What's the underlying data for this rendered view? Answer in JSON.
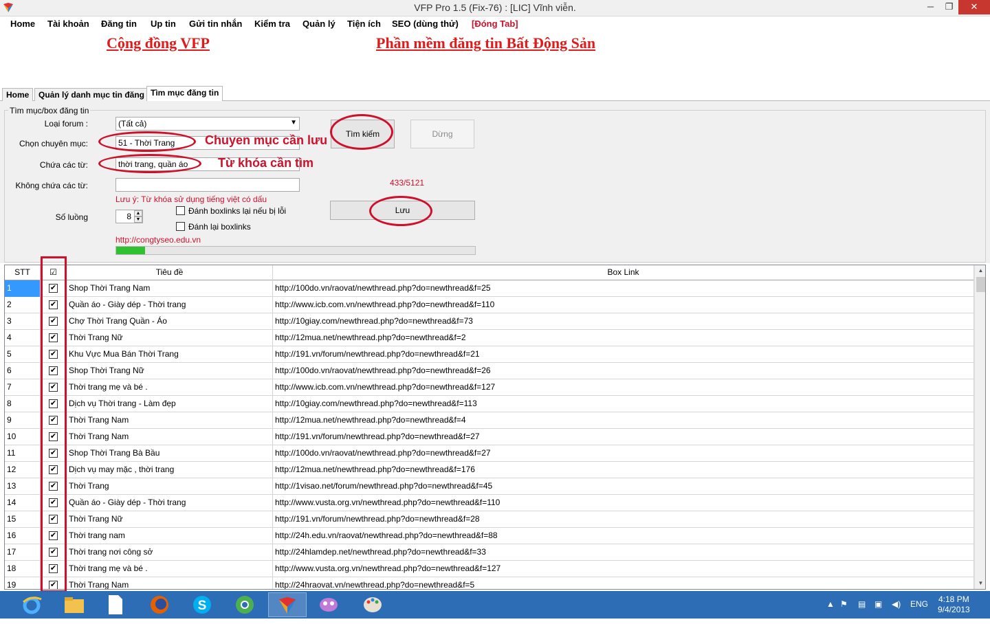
{
  "window": {
    "title": "VFP Pro 1.5 (Fix-76) : [LIC] Vĩnh viễn.",
    "min": "─",
    "max": "❐",
    "close": "✕"
  },
  "menu": [
    "Home",
    "Tài khoản",
    "Đăng tin",
    "Up tin",
    "Gửi tin nhắn",
    "Kiểm tra",
    "Quản lý",
    "Tiện ích",
    "SEO (dùng thử)",
    "[Đóng Tab]"
  ],
  "banner": {
    "left": "Cộng đồng VFP",
    "right": "Phần mềm đăng tin Bất Động Sản"
  },
  "tabs": [
    "Home",
    "Quản lý danh mục tin đăng",
    "Tìm mục đăng tin"
  ],
  "form": {
    "group_title": "Tìm mục/box đăng tin",
    "forum_type_label": "Loại forum :",
    "forum_type_value": "(Tất cả)",
    "category_label": "Chọn chuyên mục:",
    "category_value": "51 - Thời Trang",
    "contains_label": "Chứa các từ:",
    "contains_value": "thời trang, quần áo",
    "not_contains_label": "Không chứa các từ:",
    "not_contains_value": "",
    "note": "Lưu ý:  Từ khóa sử dụng tiếng việt có dấu",
    "quantity_label": "Số luồng",
    "quantity_value": "8",
    "check_repost_label": "Đánh boxlinks lại nếu bị lỗi",
    "check_relink_label": "Đánh lại boxlinks",
    "search_button": "Tìm kiếm",
    "stop_button": "Dừng",
    "save_button": "Lưu",
    "counter": "433/5121",
    "url": "http://congtyseo.edu.vn",
    "progress": 0.08
  },
  "annotations": {
    "category": "Chuyen mục cần lưu",
    "keywords": "Từ khóa cần tìm"
  },
  "grid": {
    "headers": {
      "stt": "STT",
      "check": "☑",
      "title": "Tiêu đề",
      "link": "Box Link"
    },
    "rows": [
      {
        "stt": "1",
        "title": "Shop Thời Trang Nam",
        "link": "http://100do.vn/raovat/newthread.php?do=newthread&f=25"
      },
      {
        "stt": "2",
        "title": "Quần áo - Giày dép - Thời trang",
        "link": "http://www.icb.com.vn/newthread.php?do=newthread&f=110"
      },
      {
        "stt": "3",
        "title": "Chợ Thời Trang Quần - Áo",
        "link": "http://10giay.com/newthread.php?do=newthread&f=73"
      },
      {
        "stt": "4",
        "title": "Thời Trang Nữ",
        "link": "http://12mua.net/newthread.php?do=newthread&f=2"
      },
      {
        "stt": "5",
        "title": "Khu Vực Mua Bán Thời Trang",
        "link": "http://191.vn/forum/newthread.php?do=newthread&f=21"
      },
      {
        "stt": "6",
        "title": "Shop Thời Trang Nữ",
        "link": "http://100do.vn/raovat/newthread.php?do=newthread&f=26"
      },
      {
        "stt": "7",
        "title": "Thời trang mẹ và bé .",
        "link": "http://www.icb.com.vn/newthread.php?do=newthread&f=127"
      },
      {
        "stt": "8",
        "title": "Dịch vụ Thời trang - Làm đẹp",
        "link": "http://10giay.com/newthread.php?do=newthread&f=113"
      },
      {
        "stt": "9",
        "title": "Thời Trang Nam",
        "link": "http://12mua.net/newthread.php?do=newthread&f=4"
      },
      {
        "stt": "10",
        "title": "Thời Trang Nam",
        "link": "http://191.vn/forum/newthread.php?do=newthread&f=27"
      },
      {
        "stt": "11",
        "title": "Shop Thời Trang Bà Bầu",
        "link": "http://100do.vn/raovat/newthread.php?do=newthread&f=27"
      },
      {
        "stt": "12",
        "title": "Dịch vụ may mặc , thời trang",
        "link": "http://12mua.net/newthread.php?do=newthread&f=176"
      },
      {
        "stt": "13",
        "title": "Thời Trang",
        "link": "http://1visao.net/forum/newthread.php?do=newthread&f=45"
      },
      {
        "stt": "14",
        "title": "Quần áo - Giày dép - Thời trang",
        "link": "http://www.vusta.org.vn/newthread.php?do=newthread&f=110"
      },
      {
        "stt": "15",
        "title": "Thời Trang Nữ",
        "link": "http://191.vn/forum/newthread.php?do=newthread&f=28"
      },
      {
        "stt": "16",
        "title": "Thời trang nam",
        "link": "http://24h.edu.vn/raovat/newthread.php?do=newthread&f=88"
      },
      {
        "stt": "17",
        "title": "Thời trang nơi công sở",
        "link": "http://24hlamdep.net/newthread.php?do=newthread&f=33"
      },
      {
        "stt": "18",
        "title": "Thời trang mẹ và bé .",
        "link": "http://www.vusta.org.vn/newthread.php?do=newthread&f=127"
      },
      {
        "stt": "19",
        "title": "Thời Trang Nam",
        "link": "http://24hraovat.vn/newthread.php?do=newthread&f=5"
      }
    ]
  },
  "taskbar": {
    "apps": [
      "internet-explorer-icon",
      "file-explorer-icon",
      "document-icon",
      "firefox-icon",
      "skype-icon",
      "chrome-icon",
      "vfp-icon",
      "game-icon",
      "paint-icon"
    ],
    "lang": "ENG",
    "time": "4:18 PM",
    "date": "9/4/2013"
  },
  "colors": {
    "accent_red": "#d0102a",
    "taskbar": "#2c6db6",
    "selection": "#3399ff",
    "progress": "#2fc12f"
  }
}
